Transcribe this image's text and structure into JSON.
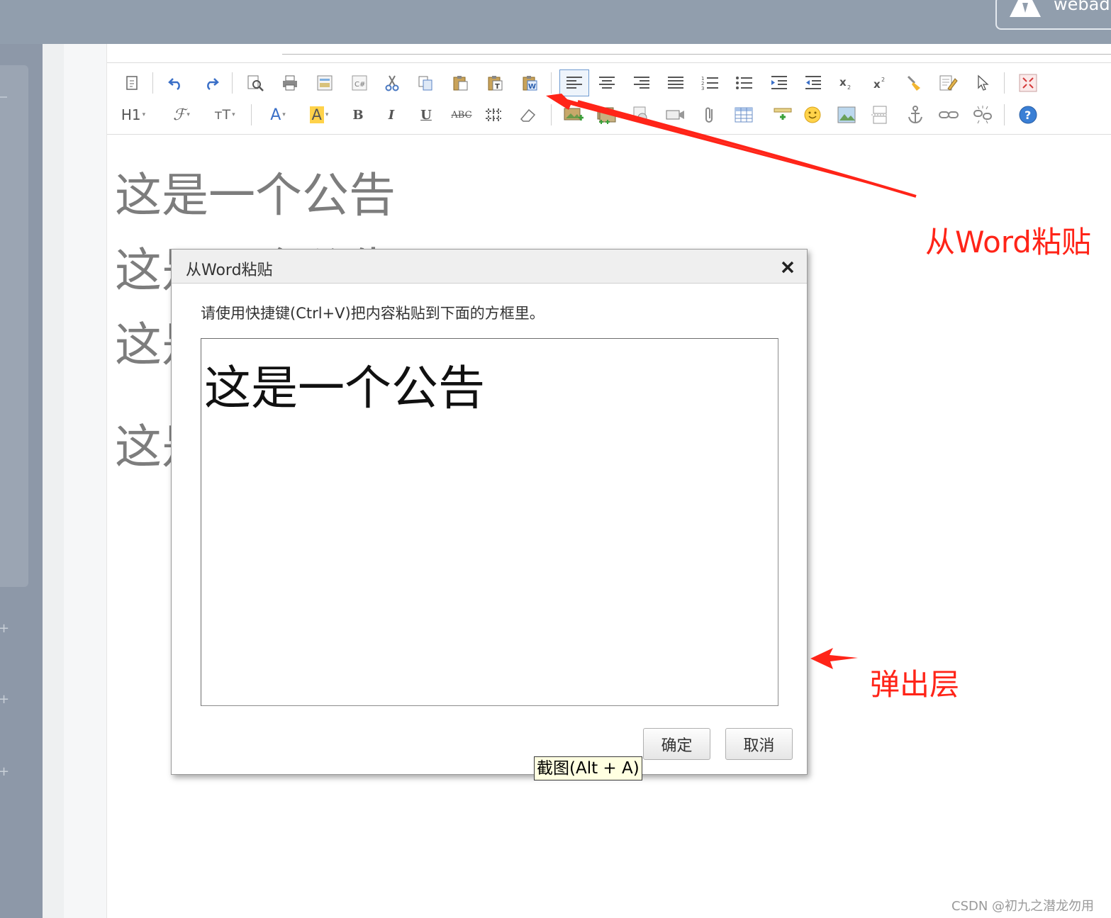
{
  "header": {
    "user_name": "webad"
  },
  "editor": {
    "content_lines": [
      "这是一个公告",
      "这是一个公告",
      "这是",
      "这是"
    ]
  },
  "toolbar": {
    "heading_label": "H1",
    "font_family_label": "ℱ",
    "font_size_label": "тT",
    "font_color_label": "A",
    "bg_color_label": "A",
    "bold_label": "B",
    "italic_label": "I",
    "underline_label": "U",
    "strike_label": "ABC"
  },
  "dialog": {
    "title": "从Word粘贴",
    "instruction": "请使用快捷键(Ctrl+V)把内容粘贴到下面的方框里。",
    "pasted_text": "这是一个公告",
    "ok_label": "确定",
    "cancel_label": "取消"
  },
  "tooltip": {
    "text": "截图(Alt + A)"
  },
  "annotations": {
    "paste_from_word": "从Word粘贴",
    "popup_layer": "弹出层"
  },
  "watermark": "CSDN @初九之潜龙勿用",
  "colors": {
    "annotation": "#ff2418",
    "active_tool": "#6f9bd1",
    "tooltip_bg": "#ffffe1"
  }
}
